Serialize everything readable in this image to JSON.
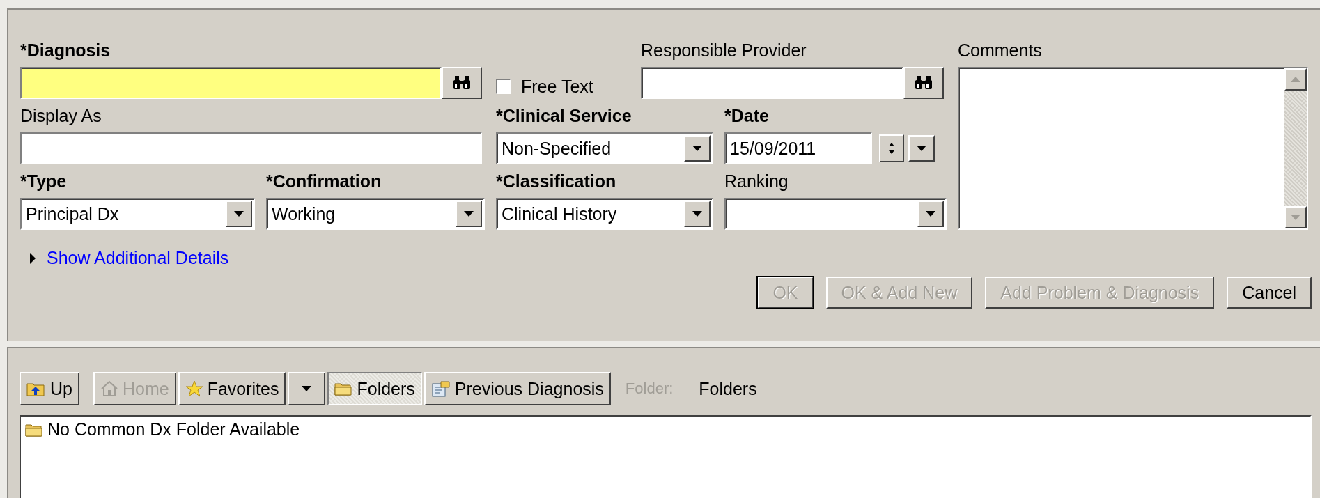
{
  "diagnosis": {
    "label": "*Diagnosis",
    "required": true,
    "highlighted": true
  },
  "free_text": {
    "label": "Free Text",
    "checked": false
  },
  "responsible_provider": {
    "label": "Responsible Provider",
    "required": false
  },
  "comments": {
    "label": "Comments"
  },
  "display_as": {
    "label": "Display As",
    "required": false
  },
  "clinical_service": {
    "label": "*Clinical Service",
    "required": true,
    "value": "Non-Specified"
  },
  "date": {
    "label": "*Date",
    "required": true,
    "value": "15/09/2011"
  },
  "type": {
    "label": "*Type",
    "required": true,
    "value": "Principal Dx"
  },
  "confirmation": {
    "label": "*Confirmation",
    "required": true,
    "value": "Working"
  },
  "classification": {
    "label": "*Classification",
    "required": true,
    "value": "Clinical History"
  },
  "ranking": {
    "label": "Ranking",
    "required": false
  },
  "details_link": {
    "label": "Show Additional Details",
    "expanded": false
  },
  "buttons": [
    {
      "label": "OK",
      "disabled": true
    },
    {
      "label": "OK & Add New",
      "disabled": true
    },
    {
      "label": "Add Problem & Diagnosis",
      "disabled": true
    },
    {
      "label": "Cancel",
      "disabled": false
    }
  ],
  "toolbar": [
    {
      "kind": "up",
      "label": "Up",
      "disabled": false,
      "selected": false
    },
    {
      "kind": "home",
      "label": "Home",
      "disabled": true,
      "selected": false
    },
    {
      "kind": "favorites",
      "label": "Favorites",
      "disabled": false,
      "selected": false
    },
    {
      "kind": "menu",
      "disabled": false,
      "selected": false
    },
    {
      "kind": "folders",
      "label": "Folders",
      "disabled": false,
      "selected": true
    },
    {
      "kind": "previous",
      "label": "Previous Diagnosis",
      "disabled": false,
      "selected": false
    }
  ],
  "folder": {
    "label": "Folder:",
    "value": "Folders"
  },
  "list": [
    {
      "label": "No Common Dx Folder Available"
    }
  ]
}
